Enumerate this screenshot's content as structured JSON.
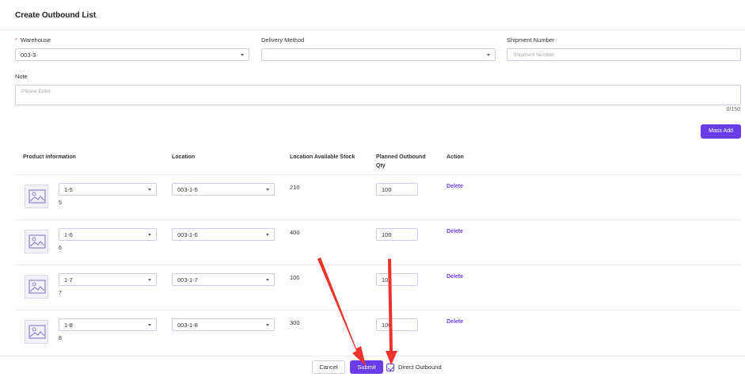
{
  "header": {
    "title": "Create Outbound List"
  },
  "form": {
    "warehouse": {
      "required_mark": "*",
      "label": "Warehouse",
      "value": "003-3"
    },
    "delivery_method": {
      "label": "Delivery Method",
      "value": ""
    },
    "shipment_number": {
      "label": "Shipment Number",
      "placeholder": "Shipment Number"
    },
    "note": {
      "label": "Note",
      "placeholder": "Please Enter",
      "counter": "0/150"
    }
  },
  "mass_add_label": "Mass Add",
  "table": {
    "headers": {
      "product": "Product information",
      "location": "Location",
      "stock": "Location Available Stock",
      "qty_line1": "Planned Outbound",
      "qty_line2": "Qty",
      "action": "Action"
    },
    "rows": [
      {
        "product": "1-5",
        "index": "5",
        "location": "003-1-5",
        "stock": "210",
        "qty": "100",
        "action": "Delete"
      },
      {
        "product": "1-6",
        "index": "6",
        "location": "003-1-6",
        "stock": "400",
        "qty": "100",
        "action": "Delete"
      },
      {
        "product": "1-7",
        "index": "7",
        "location": "003-1-7",
        "stock": "100",
        "qty": "100",
        "action": "Delete"
      },
      {
        "product": "1-8",
        "index": "8",
        "location": "003-1-8",
        "stock": "300",
        "qty": "100",
        "action": "Delete"
      }
    ]
  },
  "footer": {
    "cancel_label": "Cancel",
    "submit_label": "Submit",
    "direct_outbound_label": "Direct Outbound",
    "direct_outbound_checked": true
  },
  "colors": {
    "accent": "#6a3de8",
    "annotation": "#f0322d"
  },
  "icons": {
    "image_placeholder": "image-placeholder-icon",
    "dropdown": "chevron-down-icon"
  }
}
